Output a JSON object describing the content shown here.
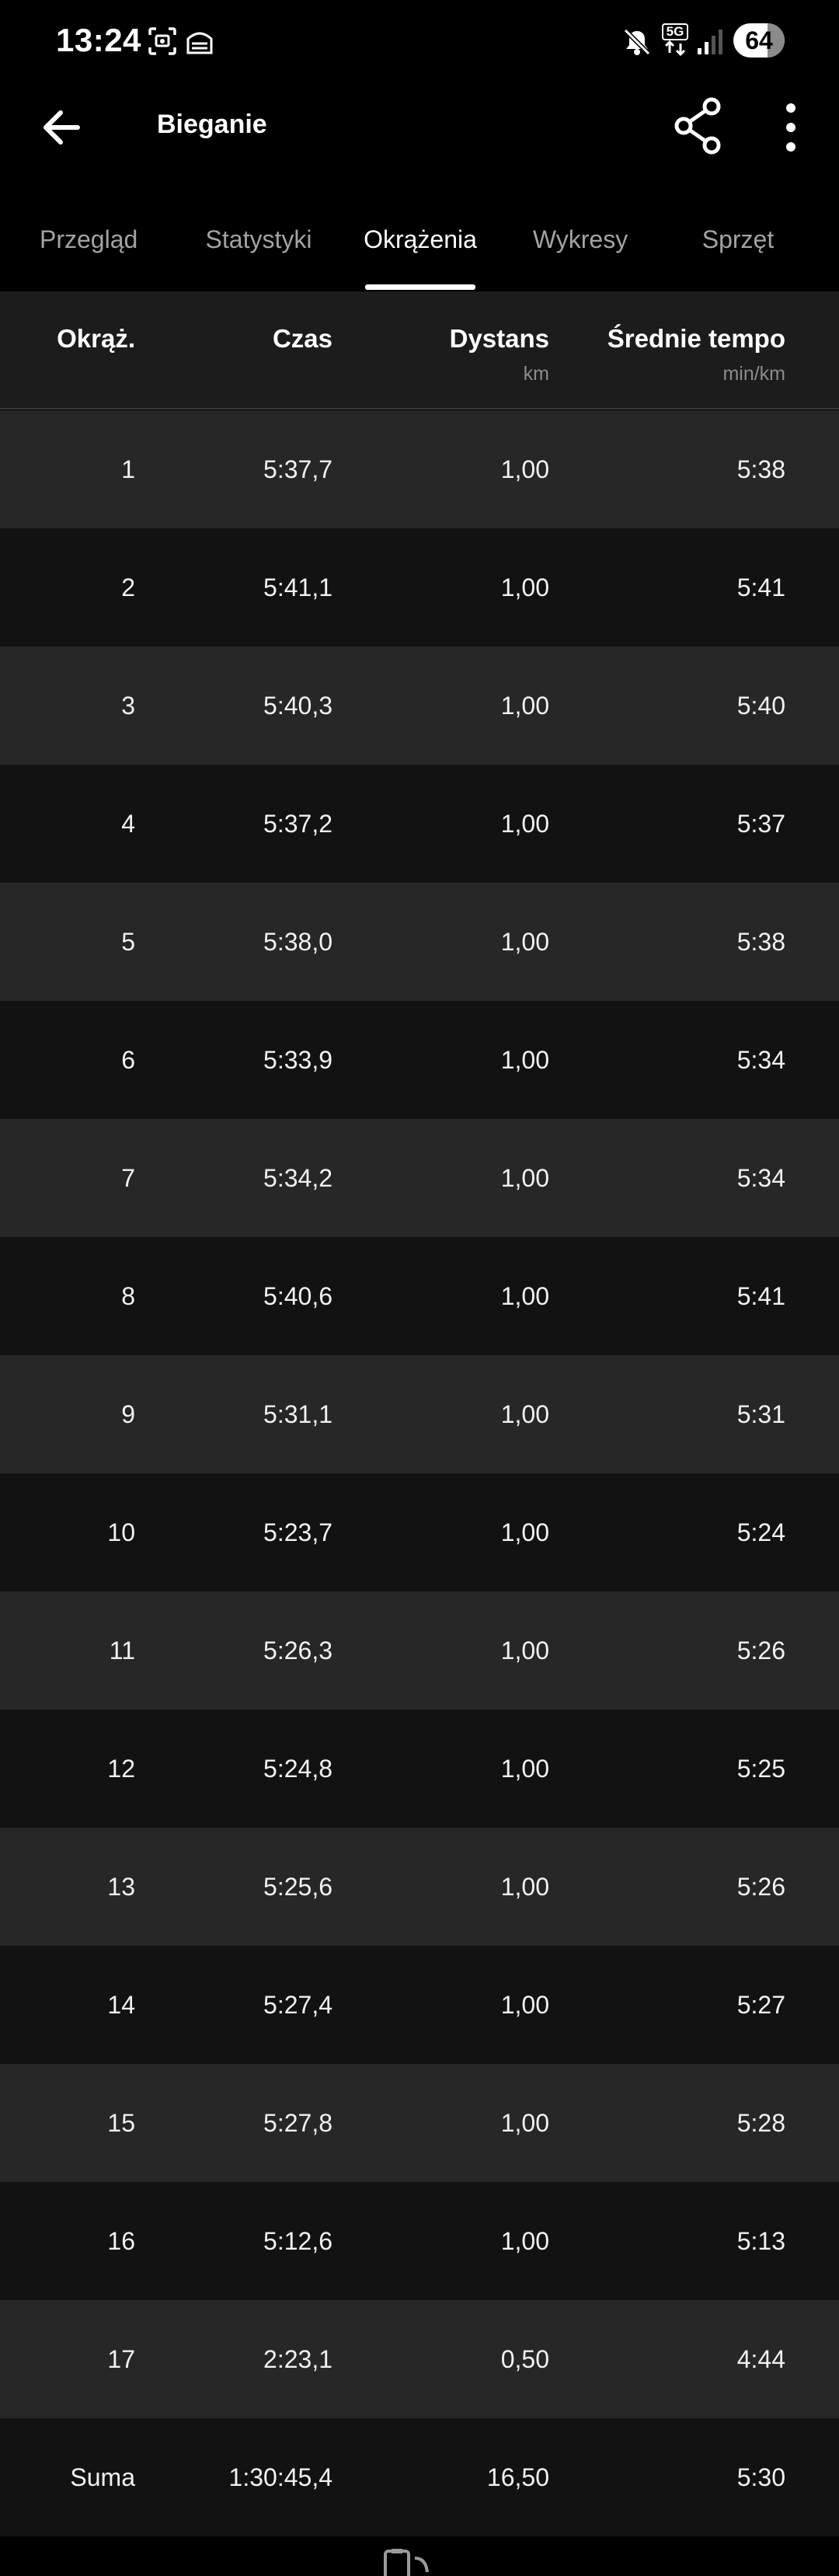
{
  "status_bar": {
    "time": "13:24",
    "battery": "64",
    "network": "5G"
  },
  "app_bar": {
    "title": "Bieganie"
  },
  "tabs": [
    {
      "label": "Przegląd",
      "active": false
    },
    {
      "label": "Statystyki",
      "active": false
    },
    {
      "label": "Okrążenia",
      "active": true
    },
    {
      "label": "Wykresy",
      "active": false
    },
    {
      "label": "Sprzęt",
      "active": false
    }
  ],
  "table": {
    "headers": {
      "lap": "Okrąż.",
      "time": "Czas",
      "distance": "Dystans",
      "distance_unit": "km",
      "pace": "Średnie tempo",
      "pace_unit": "min/km"
    },
    "rows": [
      {
        "lap": "1",
        "time": "5:37,7",
        "distance": "1,00",
        "pace": "5:38"
      },
      {
        "lap": "2",
        "time": "5:41,1",
        "distance": "1,00",
        "pace": "5:41"
      },
      {
        "lap": "3",
        "time": "5:40,3",
        "distance": "1,00",
        "pace": "5:40"
      },
      {
        "lap": "4",
        "time": "5:37,2",
        "distance": "1,00",
        "pace": "5:37"
      },
      {
        "lap": "5",
        "time": "5:38,0",
        "distance": "1,00",
        "pace": "5:38"
      },
      {
        "lap": "6",
        "time": "5:33,9",
        "distance": "1,00",
        "pace": "5:34"
      },
      {
        "lap": "7",
        "time": "5:34,2",
        "distance": "1,00",
        "pace": "5:34"
      },
      {
        "lap": "8",
        "time": "5:40,6",
        "distance": "1,00",
        "pace": "5:41"
      },
      {
        "lap": "9",
        "time": "5:31,1",
        "distance": "1,00",
        "pace": "5:31"
      },
      {
        "lap": "10",
        "time": "5:23,7",
        "distance": "1,00",
        "pace": "5:24"
      },
      {
        "lap": "11",
        "time": "5:26,3",
        "distance": "1,00",
        "pace": "5:26"
      },
      {
        "lap": "12",
        "time": "5:24,8",
        "distance": "1,00",
        "pace": "5:25"
      },
      {
        "lap": "13",
        "time": "5:25,6",
        "distance": "1,00",
        "pace": "5:26"
      },
      {
        "lap": "14",
        "time": "5:27,4",
        "distance": "1,00",
        "pace": "5:27"
      },
      {
        "lap": "15",
        "time": "5:27,8",
        "distance": "1,00",
        "pace": "5:28"
      },
      {
        "lap": "16",
        "time": "5:12,6",
        "distance": "1,00",
        "pace": "5:13"
      },
      {
        "lap": "17",
        "time": "2:23,1",
        "distance": "0,50",
        "pace": "4:44"
      }
    ],
    "summary": {
      "lap": "Suma",
      "time": "1:30:45,4",
      "distance": "16,50",
      "pace": "5:30"
    }
  },
  "icons": {
    "back": "arrow-left-icon",
    "share": "share-icon",
    "more": "more-vertical-icon",
    "device": "device-sync-icon"
  },
  "colors": {
    "background": "#000000",
    "row_odd": "#272727",
    "row_even": "#121212",
    "header_bg": "#1c1c1c",
    "text_primary": "#ffffff",
    "text_secondary": "#a3a3a3"
  }
}
